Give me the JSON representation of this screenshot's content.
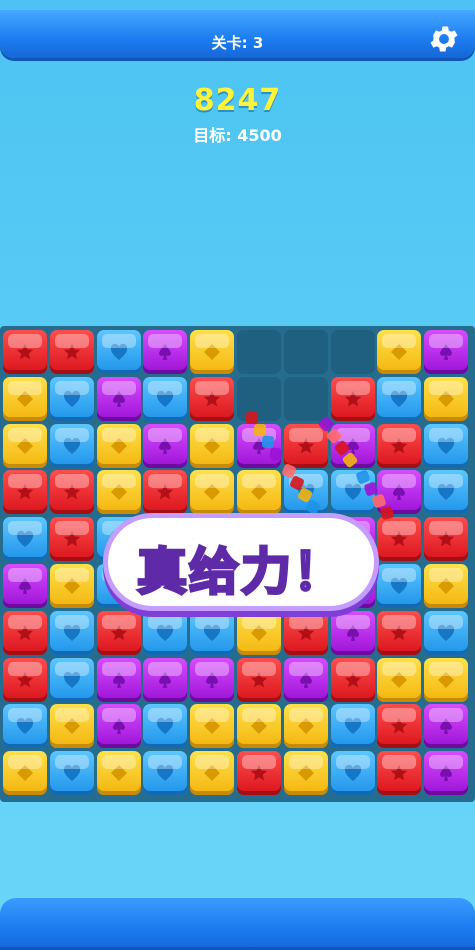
{
  "header": {
    "level_text": "关卡: 3",
    "settings_icon": "gear-icon"
  },
  "score": {
    "value": "8247",
    "target_text": "目标: 4500"
  },
  "colors": {
    "red": "#e8262c",
    "yellow": "#fbcb1f",
    "blue": "#35aef4",
    "purple": "#bb2ff0"
  },
  "board": {
    "rows": [
      [
        "red",
        "red",
        "blue",
        "purple",
        "yellow",
        "empty",
        "empty",
        "empty",
        "yellow",
        "purple"
      ],
      [
        "yellow",
        "blue",
        "purple",
        "blue",
        "red",
        "empty",
        "empty",
        "red",
        "blue",
        "yellow"
      ],
      [
        "yellow",
        "blue",
        "yellow",
        "purple",
        "yellow",
        "purple",
        "red",
        "purple",
        "red",
        "blue"
      ],
      [
        "red",
        "red",
        "yellow",
        "red",
        "yellow",
        "yellow",
        "blue",
        "blue",
        "purple",
        "blue"
      ],
      [
        "blue",
        "red",
        "blue",
        "purple",
        "purple",
        "purple",
        "purple",
        "purple",
        "red",
        "red"
      ],
      [
        "purple",
        "yellow",
        "blue",
        "red",
        "red",
        "yellow",
        "yellow",
        "purple",
        "blue",
        "yellow"
      ],
      [
        "red",
        "blue",
        "red",
        "blue",
        "blue",
        "yellow",
        "red",
        "purple",
        "red",
        "blue"
      ],
      [
        "red",
        "blue",
        "purple",
        "purple",
        "purple",
        "red",
        "purple",
        "red",
        "yellow",
        "yellow"
      ],
      [
        "blue",
        "yellow",
        "purple",
        "blue",
        "yellow",
        "yellow",
        "yellow",
        "blue",
        "red",
        "purple"
      ],
      [
        "yellow",
        "blue",
        "yellow",
        "blue",
        "yellow",
        "red",
        "yellow",
        "blue",
        "red",
        "purple"
      ]
    ]
  },
  "praise_banner": {
    "text": "真给力！"
  }
}
